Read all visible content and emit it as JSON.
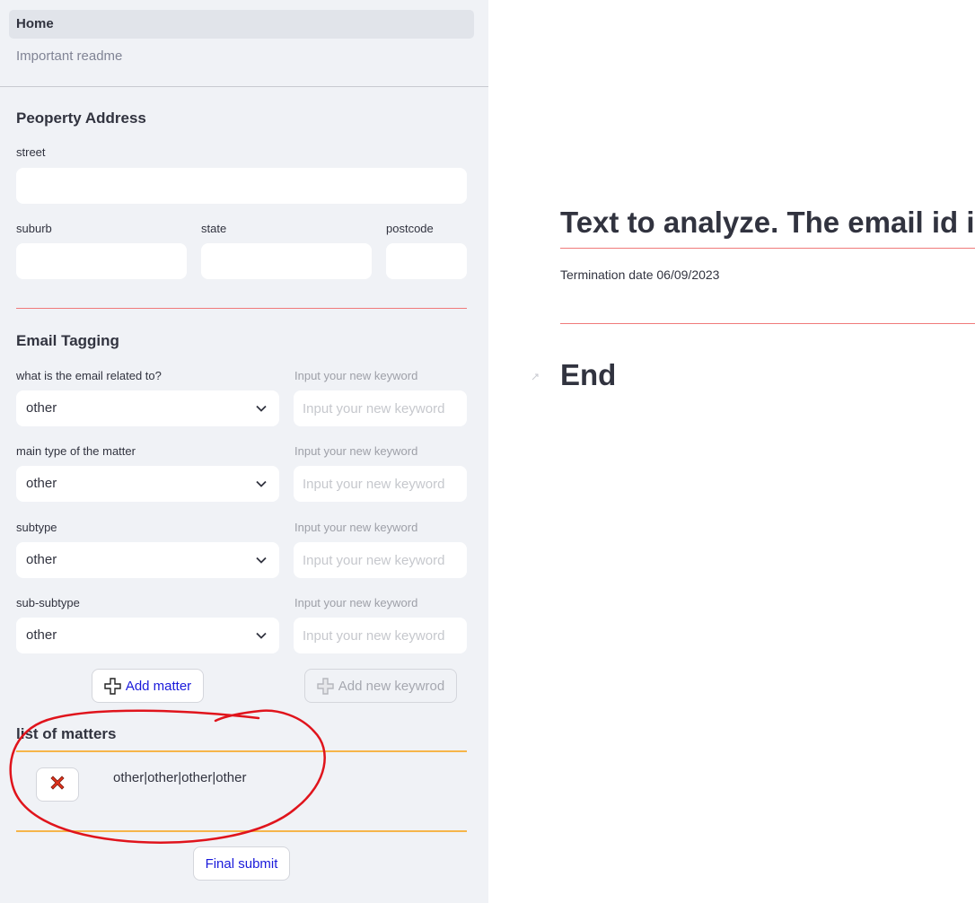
{
  "nav": {
    "items": [
      {
        "label": "Home"
      },
      {
        "label": "Important readme"
      }
    ]
  },
  "address": {
    "title": "Peoperty Address",
    "street_label": "street",
    "suburb_label": "suburb",
    "state_label": "state",
    "postcode_label": "postcode",
    "street_value": "",
    "suburb_value": "",
    "state_value": "",
    "postcode_value": ""
  },
  "tagging": {
    "title": "Email Tagging",
    "keyword_label": "Input your new keyword",
    "keyword_placeholder": "Input your new keyword",
    "rows": [
      {
        "label": "what is the email related to?",
        "value": "other"
      },
      {
        "label": "main type of the matter",
        "value": "other"
      },
      {
        "label": "subtype",
        "value": "other"
      },
      {
        "label": "sub-subtype",
        "value": "other"
      }
    ],
    "add_matter_label": "Add matter",
    "add_keyword_label": "Add new keywrod"
  },
  "matters": {
    "title": "list of matters",
    "items": [
      {
        "text": "other|other|other|other"
      }
    ],
    "final_submit_label": "Final submit"
  },
  "main": {
    "title": "Text to analyze. The email id is",
    "termination": "Termination date 06/09/2023",
    "end_title": "End"
  },
  "colors": {
    "sidebar_bg": "#f0f2f6",
    "divider_red": "#f07a7a",
    "divider_orange": "#f6b54a",
    "link_blue": "#1a1adb",
    "annotation_red": "#e0141c"
  },
  "icons": {
    "select_arrow": "chevron-down-icon",
    "add": "plus-icon",
    "delete": "cross-icon"
  }
}
